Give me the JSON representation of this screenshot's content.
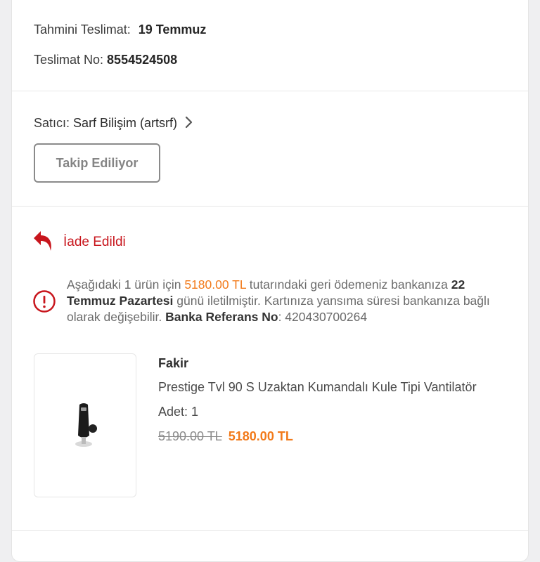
{
  "delivery": {
    "estimated_label": "Tahmini Teslimat:",
    "estimated_value": "19 Temmuz",
    "number_label": "Teslimat No:",
    "number_value": "8554524508"
  },
  "seller": {
    "label": "Satıcı:",
    "name": "Sarf Bilişim (artsrf)",
    "follow_button": "Takip Ediliyor"
  },
  "status": {
    "icon": "return-arrow-icon",
    "label": "İade Edildi",
    "color": "#c8161d"
  },
  "refund_info": {
    "icon": "info-circle-icon",
    "text_1": "Aşağıdaki 1 ürün için ",
    "amount": "5180.00 TL",
    "text_2": " tutarındaki geri ödemeniz bankanıza ",
    "date": "22 Temmuz Pazartesi",
    "text_3": " günü iletilmiştir. Kartınıza yansıma süresi bankanıza bağlı olarak değişebilir. ",
    "ref_label": "Banka Referans No",
    "ref_value": ": 420430700264"
  },
  "product": {
    "brand": "Fakir",
    "name": "Prestige Tvl 90 S Uzaktan Kumandalı Kule Tipi Vantilatör",
    "quantity": "Adet: 1",
    "old_price": "5190.00 TL",
    "new_price": "5180.00 TL"
  },
  "colors": {
    "accent_orange": "#f27a1a",
    "status_red": "#c8161d"
  }
}
